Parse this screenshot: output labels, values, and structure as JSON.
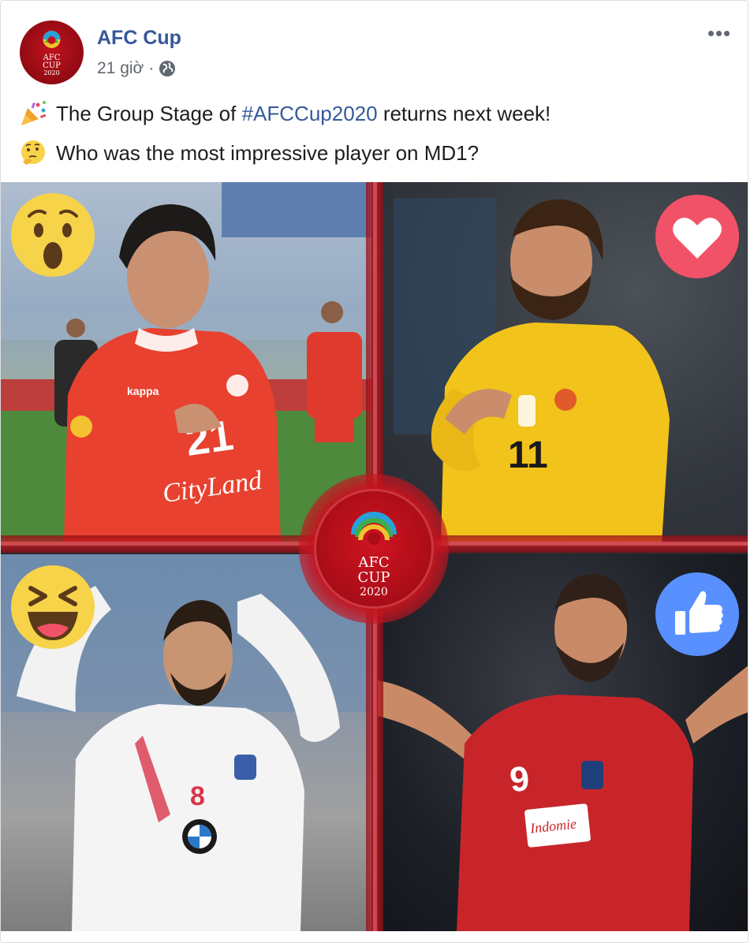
{
  "post": {
    "page_name": "AFC Cup",
    "timestamp": "21 giờ",
    "separator": "·",
    "privacy_icon": "globe-icon",
    "more_icon": "more-options-icon",
    "avatar_logo": {
      "line1": "AFC",
      "line2": "CUP",
      "line3": "2020"
    },
    "text_line1": {
      "emoji": "party-popper-emoji",
      "before": "The Group Stage of ",
      "hashtag": "#AFCCup2020",
      "after": " returns next week!"
    },
    "text_line2": {
      "emoji": "thinking-face-emoji",
      "text": "Who was the most impressive player on MD1?"
    }
  },
  "photo": {
    "center_logo": {
      "line1": "AFC",
      "line2": "CUP",
      "line3": "2020"
    },
    "quadrants": [
      {
        "reaction": "wow-reaction-icon",
        "jersey_number": "21",
        "sponsor": "CityLand",
        "kit_brand": "kappa"
      },
      {
        "reaction": "love-reaction-icon",
        "jersey_number": "11"
      },
      {
        "reaction": "haha-reaction-icon",
        "jersey_number": "8"
      },
      {
        "reaction": "like-reaction-icon",
        "jersey_number": "9",
        "sponsor": "Indomie"
      }
    ]
  },
  "colors": {
    "link": "#365899",
    "text": "#1c1e21",
    "meta": "#606770",
    "brand_red": "#c4141f",
    "love": "#f25268",
    "like": "#5890ff",
    "emoji_yellow": "#f7d34a"
  }
}
